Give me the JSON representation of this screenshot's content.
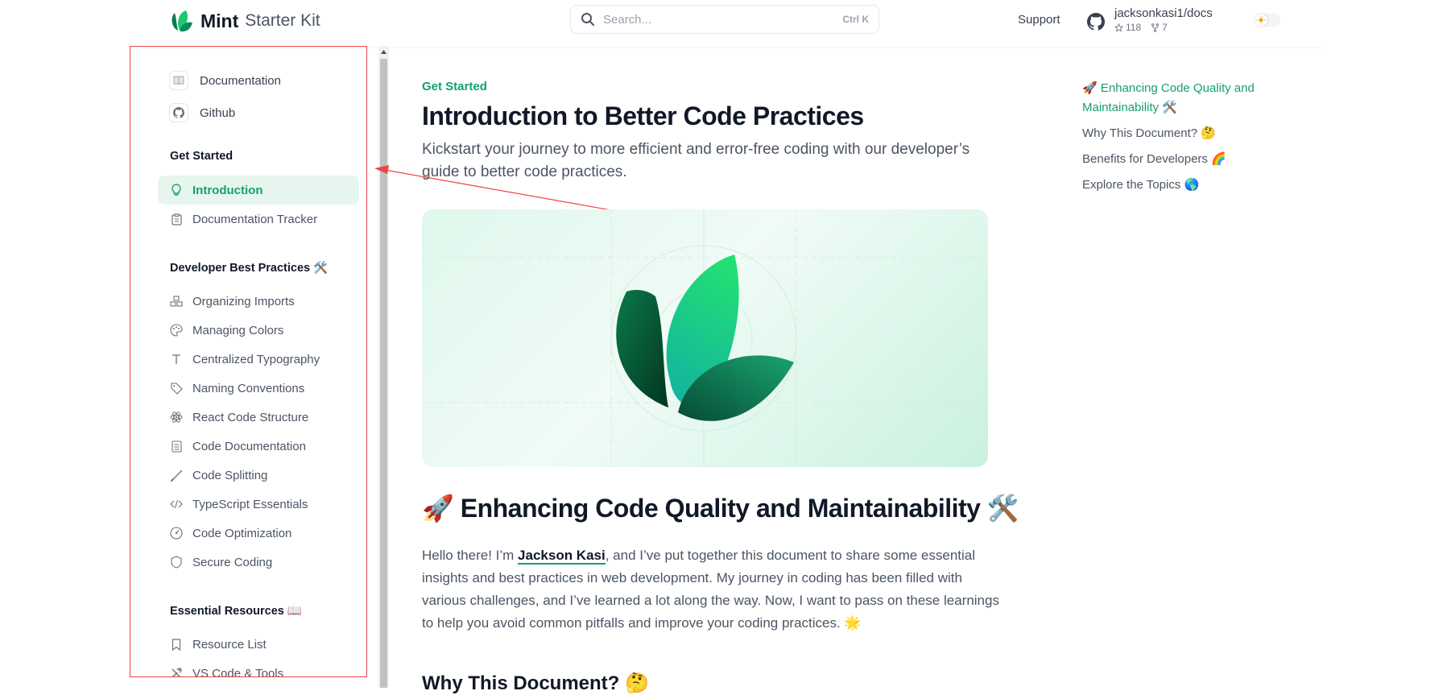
{
  "header": {
    "brand": "Mint",
    "brand_sub": "Starter Kit",
    "search_placeholder": "Search...",
    "search_shortcut": "Ctrl K",
    "support_label": "Support",
    "repo_name": "jacksonkasi1/docs",
    "repo_stars": "118",
    "repo_forks": "7"
  },
  "sidebar": {
    "top_links": [
      {
        "label": "Documentation",
        "icon": "book-icon"
      },
      {
        "label": "Github",
        "icon": "github-icon"
      }
    ],
    "sections": [
      {
        "title": "Get Started",
        "items": [
          {
            "label": "Introduction",
            "icon": "lightbulb-icon",
            "active": true
          },
          {
            "label": "Documentation Tracker",
            "icon": "clipboard-icon"
          }
        ]
      },
      {
        "title": "Developer Best Practices 🛠️",
        "items": [
          {
            "label": "Organizing Imports",
            "icon": "boxes-icon"
          },
          {
            "label": "Managing Colors",
            "icon": "palette-icon"
          },
          {
            "label": "Centralized Typography",
            "icon": "type-icon"
          },
          {
            "label": "Naming Conventions",
            "icon": "tag-icon"
          },
          {
            "label": "React Code Structure",
            "icon": "atom-icon"
          },
          {
            "label": "Code Documentation",
            "icon": "document-icon"
          },
          {
            "label": "Code Splitting",
            "icon": "slash-icon"
          },
          {
            "label": "TypeScript Essentials",
            "icon": "code-icon"
          },
          {
            "label": "Code Optimization",
            "icon": "gauge-icon"
          },
          {
            "label": "Secure Coding",
            "icon": "shield-icon"
          }
        ]
      },
      {
        "title": "Essential Resources 📖",
        "items": [
          {
            "label": "Resource List",
            "icon": "bookmark-icon"
          },
          {
            "label": "VS Code & Tools",
            "icon": "tools-icon"
          }
        ]
      }
    ]
  },
  "main": {
    "breadcrumb": "Get Started",
    "title": "Introduction to Better Code Practices",
    "lede": "Kickstart your journey to more efficient and error-free coding with our developer’s guide to better code practices.",
    "h2": "🚀 Enhancing Code Quality and Maintainability 🛠️",
    "para_before": "Hello there! I’m ",
    "para_link": "Jackson Kasi",
    "para_after": ", and I’ve put together this document to share some essential insights and best practices in web development. My journey in coding has been filled with various challenges, and I’ve learned a lot along the way. Now, I want to pass on these learnings to help you avoid common pitfalls and improve your coding practices. 🌟",
    "h3": "Why This Document? 🤔"
  },
  "toc": [
    {
      "label": "🚀 Enhancing Code Quality and Maintainability 🛠️",
      "active": true
    },
    {
      "label": "Why This Document? 🤔"
    },
    {
      "label": "Benefits for Developers 🌈"
    },
    {
      "label": "Explore the Topics 🌎"
    }
  ],
  "colors": {
    "accent": "#16a06a",
    "active_bg": "#e6f6ef",
    "annotation": "#ef4444"
  }
}
